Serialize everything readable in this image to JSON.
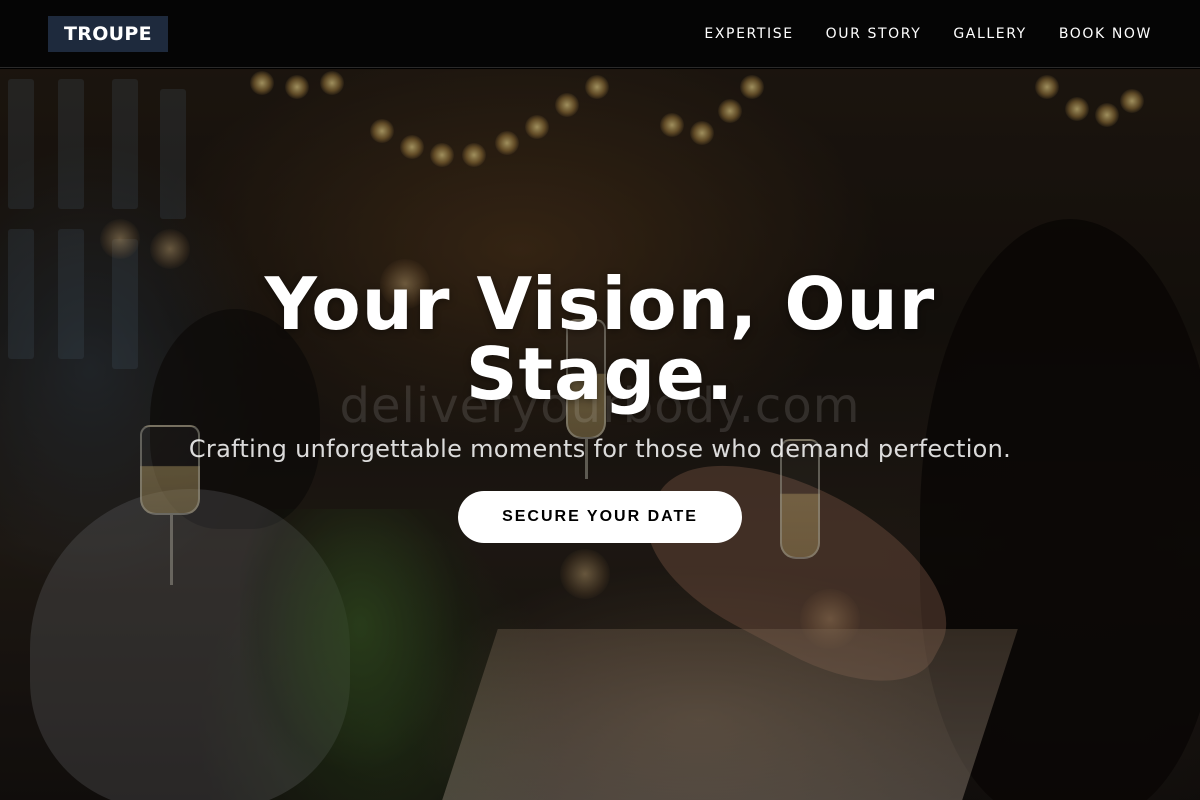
{
  "header": {
    "logo": "TROUPE",
    "nav": [
      {
        "label": "EXPERTISE"
      },
      {
        "label": "OUR STORY"
      },
      {
        "label": "GALLERY"
      },
      {
        "label": "BOOK NOW"
      }
    ]
  },
  "hero": {
    "title": "Your Vision, Our Stage.",
    "subtitle": "Crafting unforgettable moments for those who demand perfection.",
    "cta_label": "SECURE YOUR DATE",
    "watermark": "deliveryourbody.com"
  },
  "colors": {
    "header_bg": "#050505",
    "logo_bg": "#1e2a3d",
    "text": "#ffffff",
    "cta_bg": "#ffffff",
    "cta_text": "#000000"
  }
}
